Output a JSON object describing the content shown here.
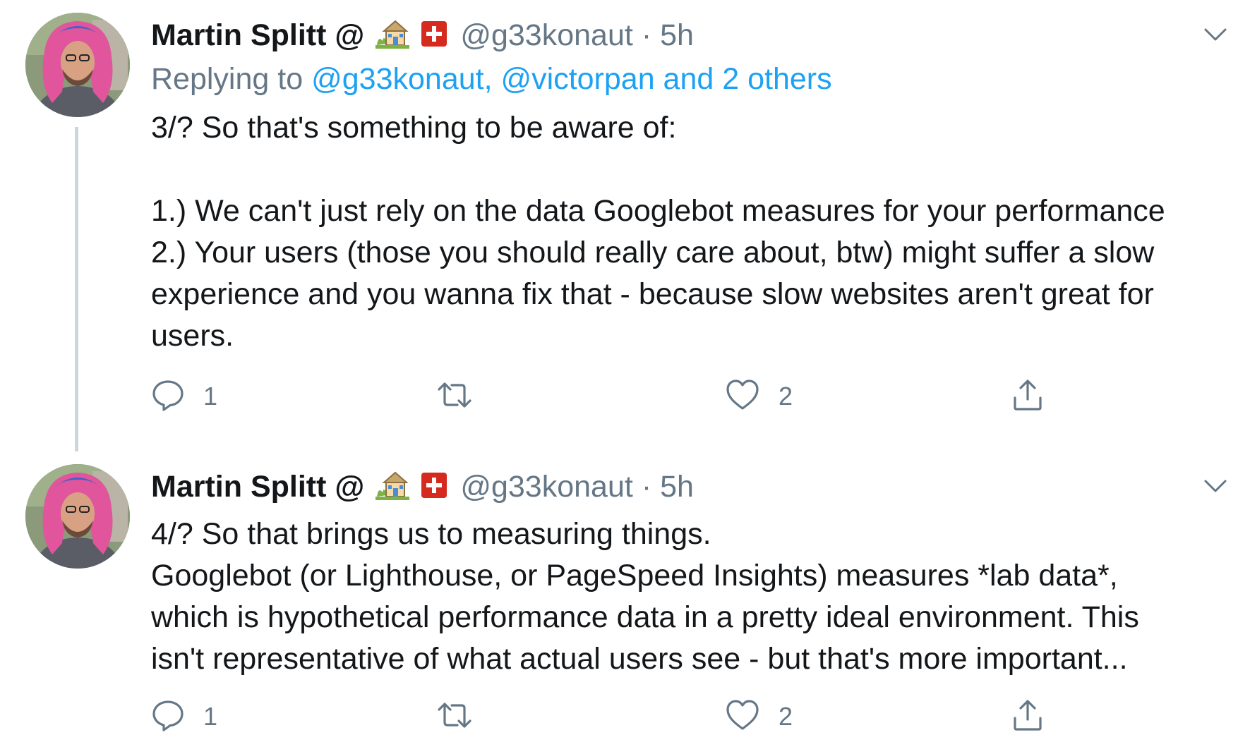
{
  "tweets": [
    {
      "author": {
        "display_name": "Martin Splitt @",
        "emoji": [
          "house-with-garden-icon",
          "swiss-flag-icon"
        ],
        "handle": "@g33konaut",
        "separator": "·",
        "time": "5h"
      },
      "reply": {
        "prefix": "Replying to",
        "mentions": "@g33konaut, @victorpan and 2 others"
      },
      "body": [
        "3/? So that's something to be aware of:",
        "",
        "1.) We can't just rely on the data Googlebot measures for your performance",
        "2.) Your users (those you should really care about, btw) might suffer a slow",
        "experience and you wanna fix that - because slow websites aren't great for",
        "users."
      ],
      "actions": {
        "reply_count": "1",
        "retweet_count": "",
        "like_count": "2"
      }
    },
    {
      "author": {
        "display_name": "Martin Splitt @",
        "emoji": [
          "house-with-garden-icon",
          "swiss-flag-icon"
        ],
        "handle": "@g33konaut",
        "separator": "·",
        "time": "5h"
      },
      "body": [
        "4/? So that brings us to measuring things.",
        "Googlebot (or Lighthouse, or PageSpeed Insights) measures *lab data*,",
        "which is hypothetical performance data in a pretty ideal environment. This",
        "isn't representative of what actual users see - but that's more important..."
      ],
      "actions": {
        "reply_count": "1",
        "retweet_count": "",
        "like_count": "2"
      }
    }
  ],
  "colors": {
    "text": "#14171a",
    "secondary": "#657786",
    "link": "#1da1f2",
    "thread_line": "#ccd6dd",
    "swiss_red": "#d52b1e"
  },
  "icons": {
    "reply": "comment-icon",
    "retweet": "retweet-icon",
    "like": "heart-icon",
    "share": "share-icon",
    "menu": "chevron-down-icon"
  }
}
